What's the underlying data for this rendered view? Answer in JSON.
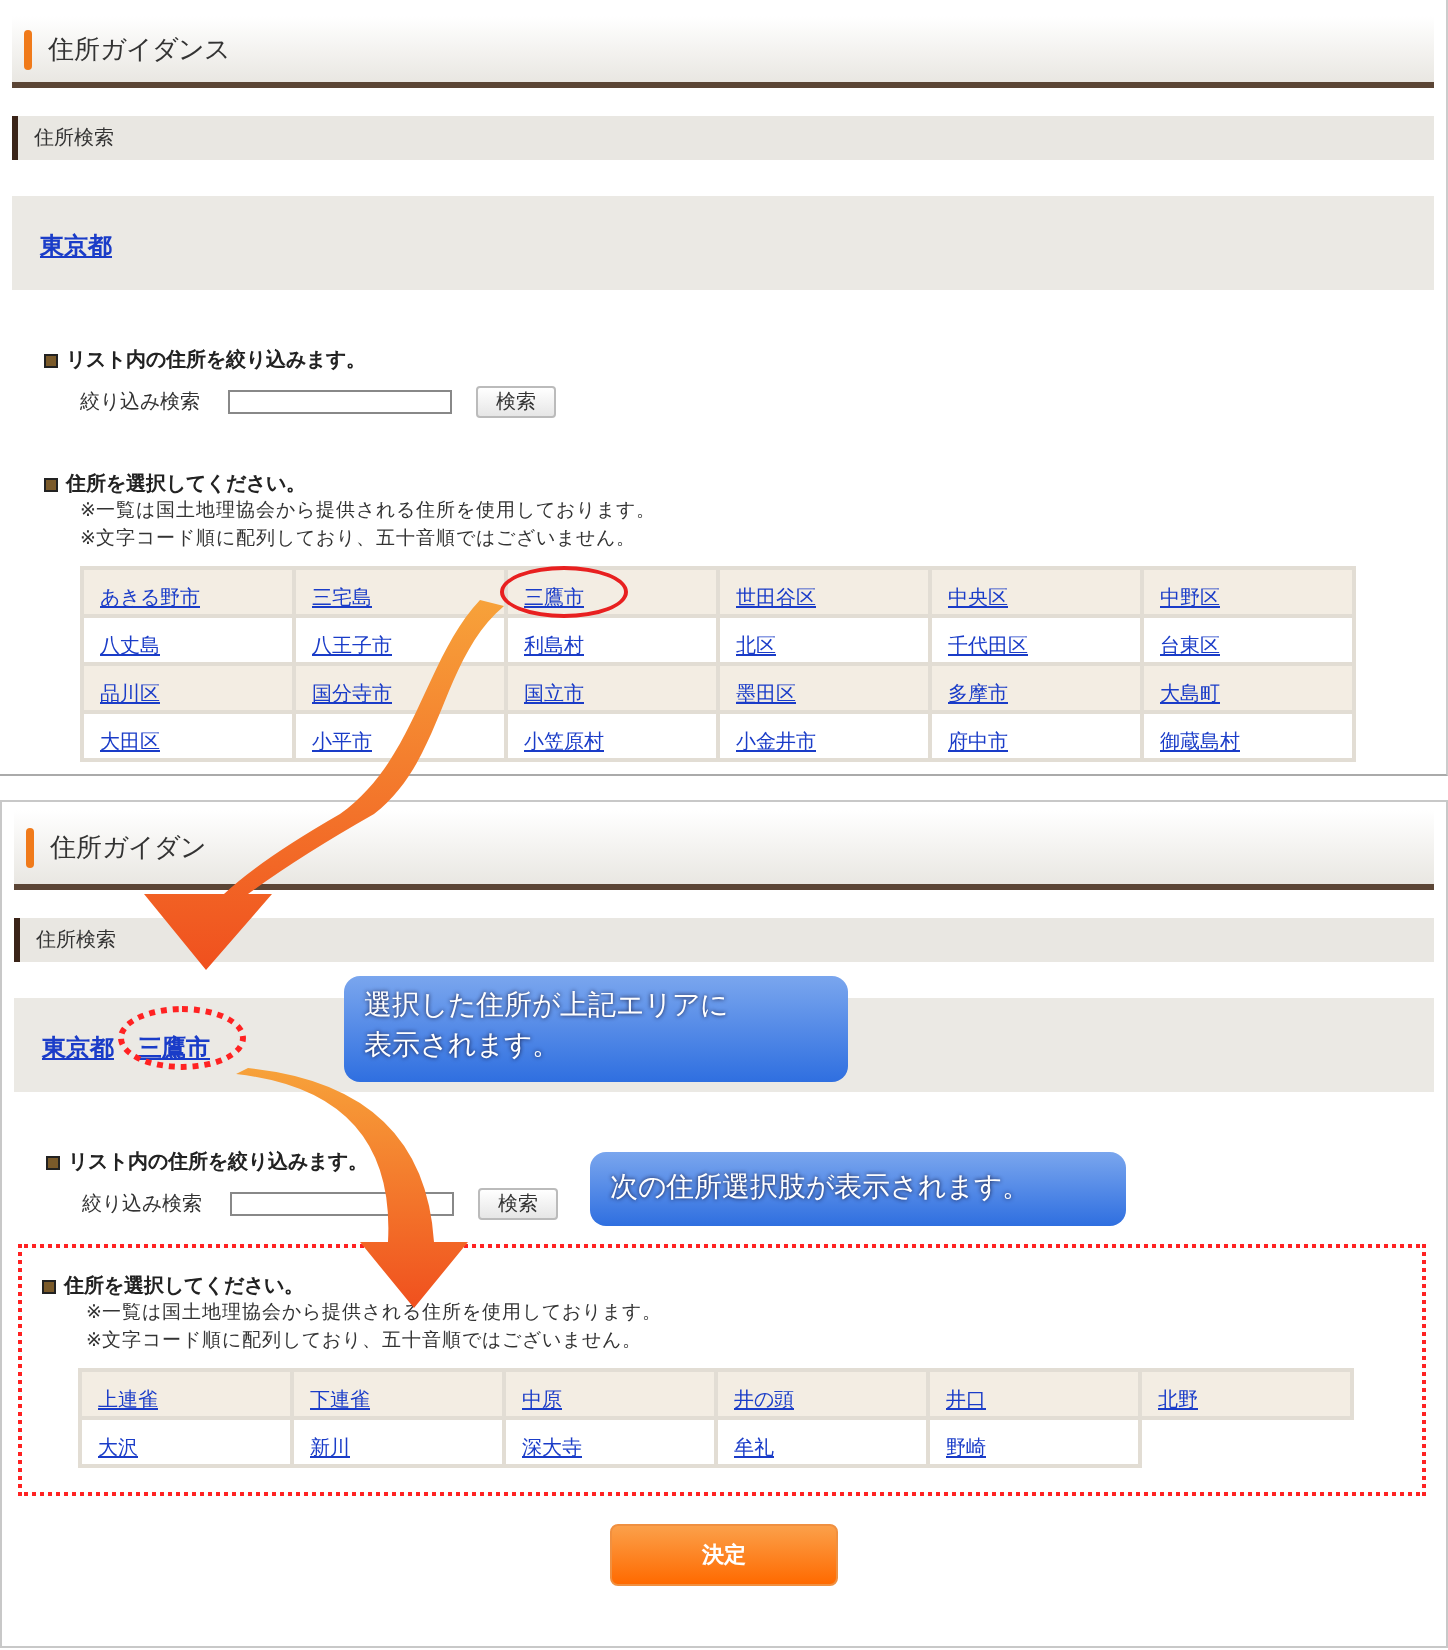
{
  "panels": [
    {
      "title": "住所ガイダンス",
      "section": "住所検索",
      "breadcrumb": [
        {
          "label": "東京都",
          "circled": false
        }
      ],
      "filter": {
        "heading": "リスト内の住所を絞り込みます。",
        "label": "絞り込み検索",
        "button": "検索"
      },
      "select": {
        "heading": "住所を選択してください。",
        "outlined": false,
        "notes": [
          "※一覧は国土地理協会から提供される住所を使用しております。",
          "※文字コード順に配列しており、五十音順ではございません。"
        ],
        "rows": [
          [
            {
              "label": "あきる野市",
              "circled": false
            },
            {
              "label": "三宅島",
              "circled": false
            },
            {
              "label": "三鷹市",
              "circled": true
            },
            {
              "label": "世田谷区",
              "circled": false
            },
            {
              "label": "中央区",
              "circled": false
            },
            {
              "label": "中野区",
              "circled": false
            }
          ],
          [
            {
              "label": "八丈島",
              "circled": false
            },
            {
              "label": "八王子市",
              "circled": false
            },
            {
              "label": "利島村",
              "circled": false
            },
            {
              "label": "北区",
              "circled": false
            },
            {
              "label": "千代田区",
              "circled": false
            },
            {
              "label": "台東区",
              "circled": false
            }
          ],
          [
            {
              "label": "品川区",
              "circled": false
            },
            {
              "label": "国分寺市",
              "circled": false
            },
            {
              "label": "国立市",
              "circled": false
            },
            {
              "label": "墨田区",
              "circled": false
            },
            {
              "label": "多摩市",
              "circled": false
            },
            {
              "label": "大島町",
              "circled": false
            }
          ],
          [
            {
              "label": "大田区",
              "circled": false
            },
            {
              "label": "小平市",
              "circled": false
            },
            {
              "label": "小笠原村",
              "circled": false
            },
            {
              "label": "小金井市",
              "circled": false
            },
            {
              "label": "府中市",
              "circled": false
            },
            {
              "label": "御蔵島村",
              "circled": false
            }
          ]
        ]
      }
    },
    {
      "title": "住所ガイダン",
      "section": "住所検索",
      "breadcrumb": [
        {
          "label": "東京都",
          "circled": false
        },
        {
          "label": "三鷹市",
          "circled": true
        }
      ],
      "filter": {
        "heading": "リスト内の住所を絞り込みます。",
        "label": "絞り込み検索",
        "button": "検索"
      },
      "select": {
        "heading": "住所を選択してください。",
        "outlined": true,
        "notes": [
          "※一覧は国土地理協会から提供される住所を使用しております。",
          "※文字コード順に配列しており、五十音順ではございません。"
        ],
        "rows": [
          [
            {
              "label": "上連雀",
              "circled": false
            },
            {
              "label": "下連雀",
              "circled": false
            },
            {
              "label": "中原",
              "circled": false
            },
            {
              "label": "井の頭",
              "circled": false
            },
            {
              "label": "井口",
              "circled": false
            },
            {
              "label": "北野",
              "circled": false
            }
          ],
          [
            {
              "label": "大沢",
              "circled": false
            },
            {
              "label": "新川",
              "circled": false
            },
            {
              "label": "深大寺",
              "circled": false
            },
            {
              "label": "牟礼",
              "circled": false
            },
            {
              "label": "野崎",
              "circled": false
            }
          ]
        ]
      },
      "decide_button": "決定"
    }
  ],
  "callouts": [
    {
      "lines": [
        "選択した住所が上記エリアに",
        "表示されます。"
      ]
    },
    {
      "lines": [
        "次の住所選択肢が表示されます。"
      ]
    }
  ]
}
